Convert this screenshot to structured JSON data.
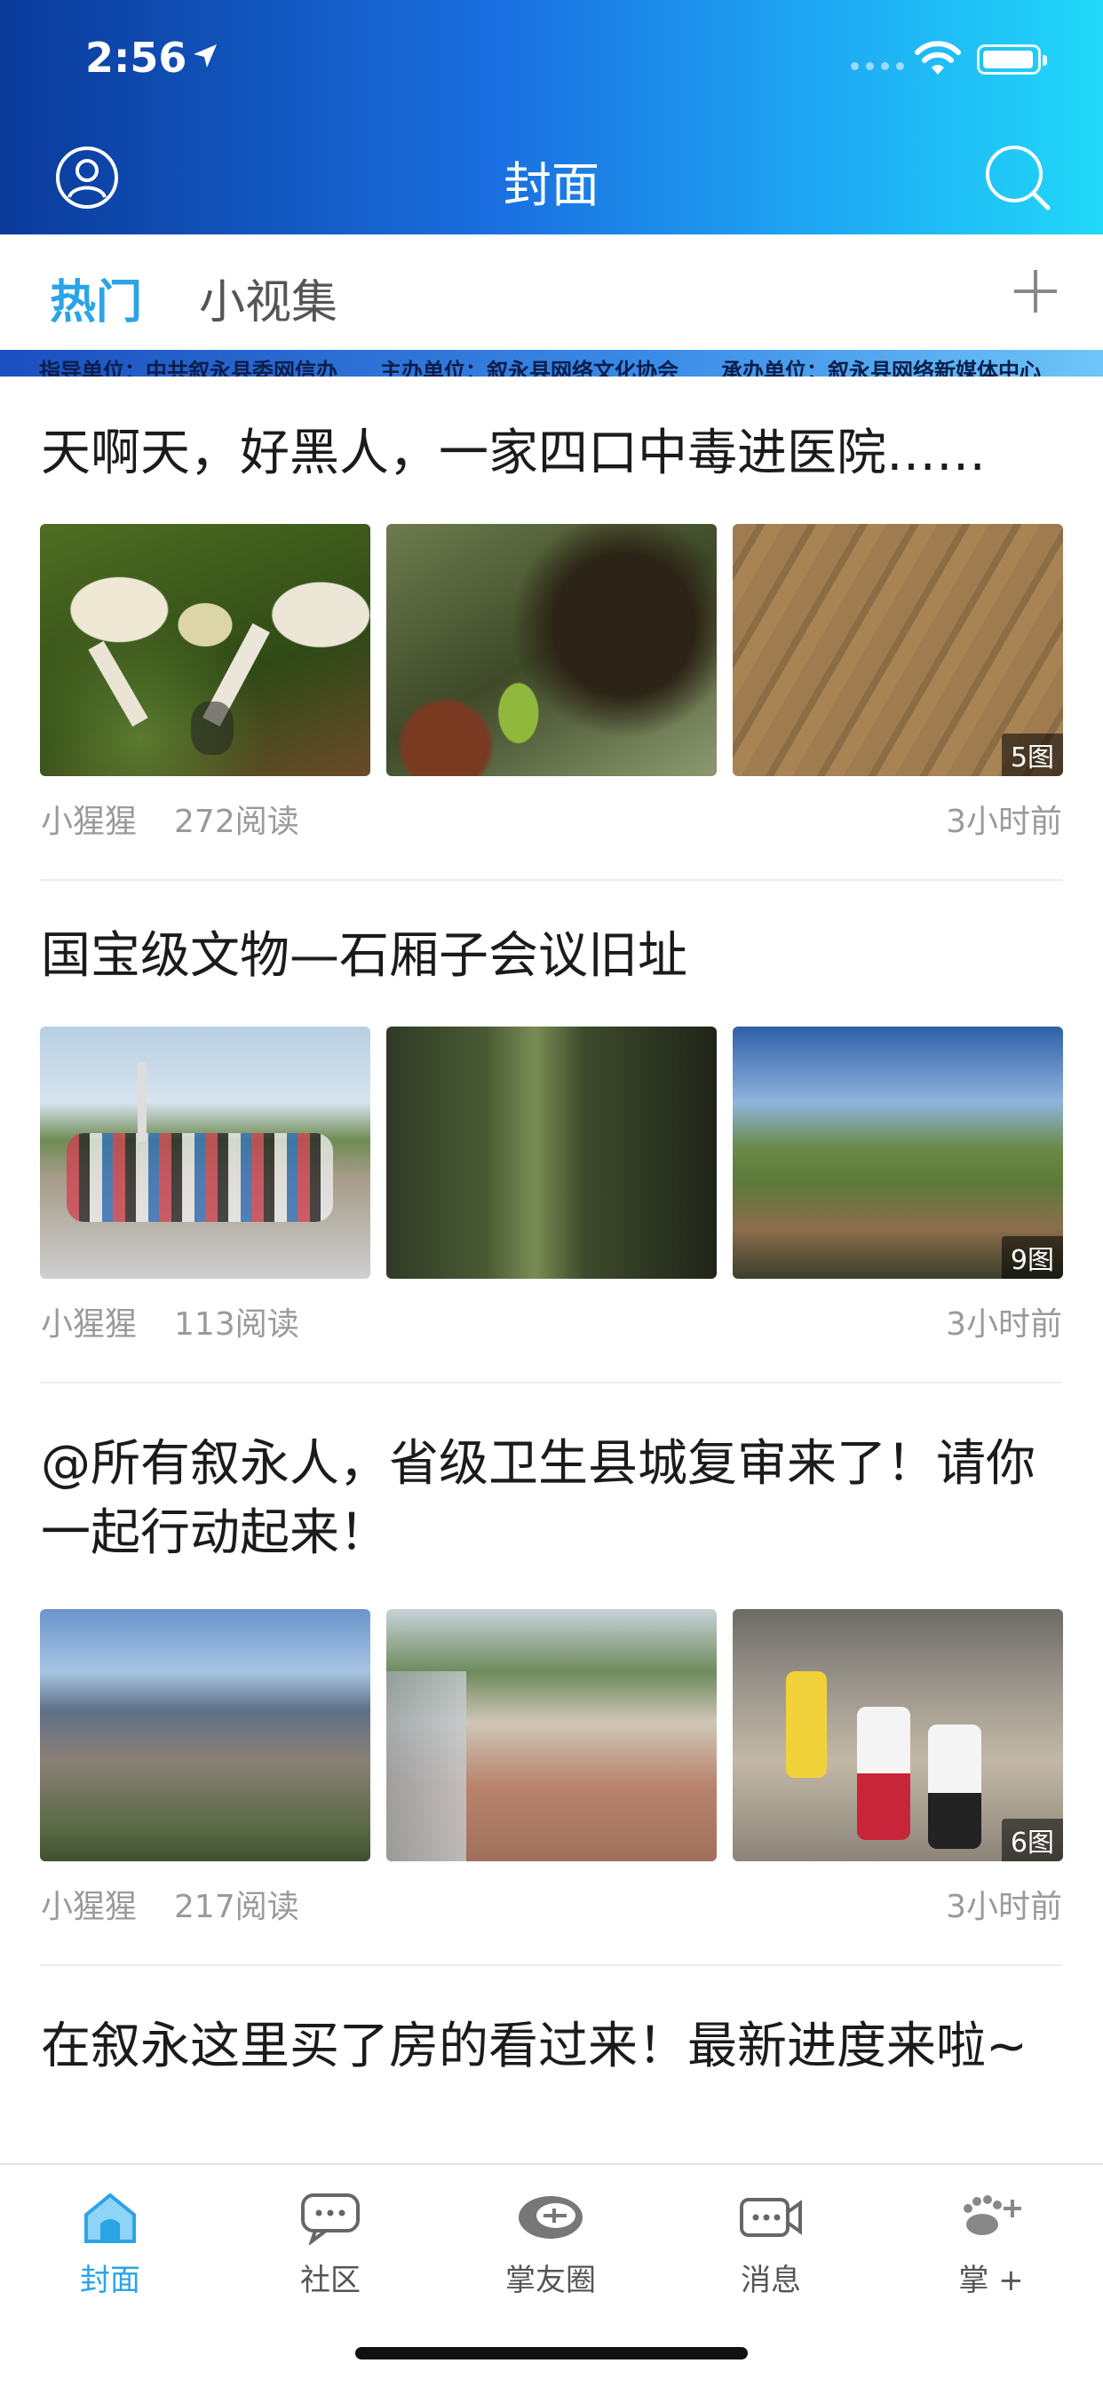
{
  "status_bar": {
    "time": "2:56"
  },
  "header": {
    "title": "封面"
  },
  "tabs": [
    {
      "label": "热门",
      "active": true
    },
    {
      "label": "小视集",
      "active": false
    }
  ],
  "ticker": {
    "text": "指导单位：中共叙永县委网信办　　主办单位：叙永县网络文化协会　　承办单位：叙永县网络新媒体中心"
  },
  "articles": [
    {
      "title": "天啊天，好黑人，一家四口中毒进医院……",
      "author": "小猩猩",
      "reads": "272阅读",
      "time": "3小时前",
      "image_count": "5图"
    },
    {
      "title": "国宝级文物—石厢子会议旧址",
      "author": "小猩猩",
      "reads": "113阅读",
      "time": "3小时前",
      "image_count": "9图"
    },
    {
      "title": "@所有叙永人，省级卫生县城复审来了！请你一起行动起来！",
      "author": "小猩猩",
      "reads": "217阅读",
      "time": "3小时前",
      "image_count": "6图"
    },
    {
      "title": "在叙永这里买了房的看过来！最新进度来啦~"
    }
  ],
  "tabbar": [
    {
      "label": "封面",
      "icon": "home-icon",
      "active": true
    },
    {
      "label": "社区",
      "icon": "community-chat-icon",
      "active": false
    },
    {
      "label": "掌友圈",
      "icon": "xuyong-logo-icon",
      "active": false
    },
    {
      "label": "消息",
      "icon": "message-video-icon",
      "active": false
    },
    {
      "label": "掌 +",
      "icon": "palm-plus-icon",
      "active": false
    }
  ],
  "colors": {
    "accent": "#2aa4e6",
    "header_start": "#0a3a9a",
    "header_end": "#20d8f8"
  }
}
